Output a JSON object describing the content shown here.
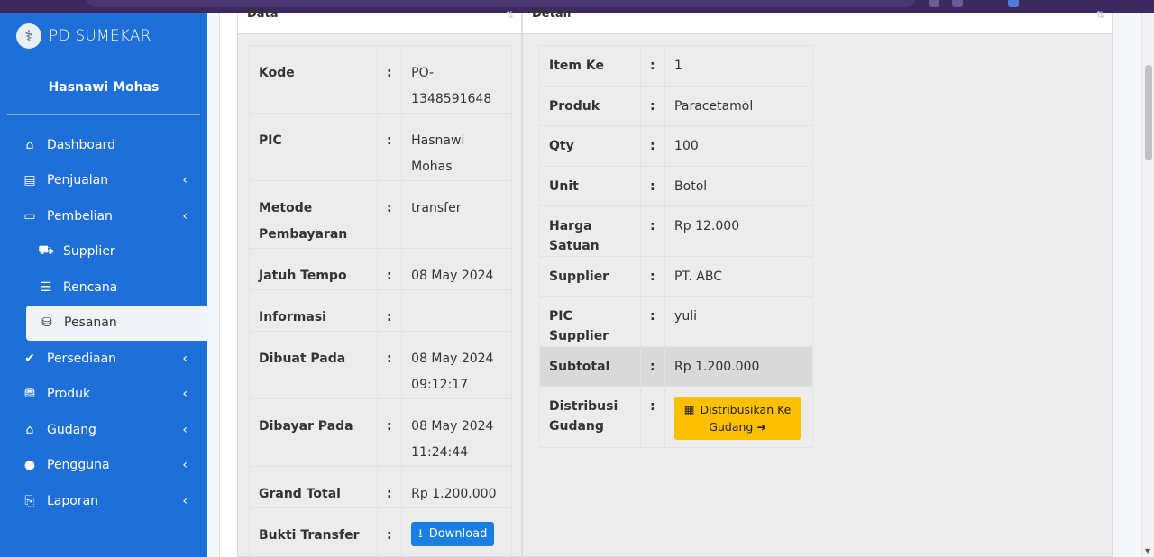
{
  "app": {
    "brand": "PD SUMEKAR",
    "user_name": "Hasnawi Mohas"
  },
  "sidebar": {
    "items": [
      {
        "label": "Dashboard",
        "icon": "home-icon",
        "glyph": "⌂"
      },
      {
        "label": "Penjualan",
        "icon": "cash-register-icon",
        "glyph": "▤",
        "chevron": "‹"
      },
      {
        "label": "Pembelian",
        "icon": "credit-card-icon",
        "glyph": "▭",
        "chevron": "‹"
      },
      {
        "label": "Supplier",
        "icon": "truck-icon",
        "glyph": "⛟"
      },
      {
        "label": "Rencana",
        "icon": "list-icon",
        "glyph": "☰"
      },
      {
        "label": "Pesanan",
        "icon": "hand-holding-icon",
        "glyph": "⛁"
      },
      {
        "label": "Persediaan",
        "icon": "check-icon",
        "glyph": "✔",
        "chevron": "‹"
      },
      {
        "label": "Produk",
        "icon": "database-icon",
        "glyph": "⛃",
        "chevron": "‹"
      },
      {
        "label": "Gudang",
        "icon": "warehouse-icon",
        "glyph": "⌂",
        "chevron": "‹"
      },
      {
        "label": "Pengguna",
        "icon": "user-icon",
        "glyph": "●",
        "chevron": "‹"
      },
      {
        "label": "Laporan",
        "icon": "file-export-icon",
        "glyph": "⎘",
        "chevron": "‹"
      }
    ]
  },
  "panels": {
    "data": {
      "title": "Data",
      "rows": [
        {
          "key": "Kode",
          "sep": ":",
          "value": "PO-1348591648"
        },
        {
          "key": "PIC",
          "sep": ":",
          "value": "Hasnawi Mohas"
        },
        {
          "key": "Metode Pembayaran",
          "sep": ":",
          "value": "transfer"
        },
        {
          "key": "Jatuh Tempo",
          "sep": ":",
          "value": "08 May 2024"
        },
        {
          "key": "Informasi",
          "sep": ":",
          "value": ""
        },
        {
          "key": "Dibuat Pada",
          "sep": ":",
          "value": "08 May 2024 09:12:17"
        },
        {
          "key": "Dibayar Pada",
          "sep": ":",
          "value": "08 May 2024 11:24:44"
        },
        {
          "key": "Grand Total",
          "sep": ":",
          "value": "Rp 1.200.000"
        },
        {
          "key": "Bukti Transfer",
          "sep": ":",
          "button": "Download"
        }
      ]
    },
    "detail": {
      "title": "Detail",
      "rows": [
        {
          "key": "Item Ke",
          "sep": ":",
          "value": "1"
        },
        {
          "key": "Produk",
          "sep": ":",
          "value": "Paracetamol"
        },
        {
          "key": "Qty",
          "sep": ":",
          "value": "100"
        },
        {
          "key": "Unit",
          "sep": ":",
          "value": "Botol"
        },
        {
          "key": "Harga Satuan",
          "sep": ":",
          "value": "Rp 12.000"
        },
        {
          "key": "Supplier",
          "sep": ":",
          "value": "PT. ABC"
        },
        {
          "key": "PIC Supplier",
          "sep": ":",
          "value": "yuli"
        },
        {
          "key": "Subtotal",
          "sep": ":",
          "value": "Rp 1.200.000"
        },
        {
          "key": "Distribusi Gudang",
          "sep": ":",
          "button": "Distribusikan Ke Gudang"
        }
      ]
    }
  },
  "colors": {
    "sidebar": "#1f6fd8",
    "download_button": "#1a7fe0",
    "distribute_button": "#fcc000"
  }
}
